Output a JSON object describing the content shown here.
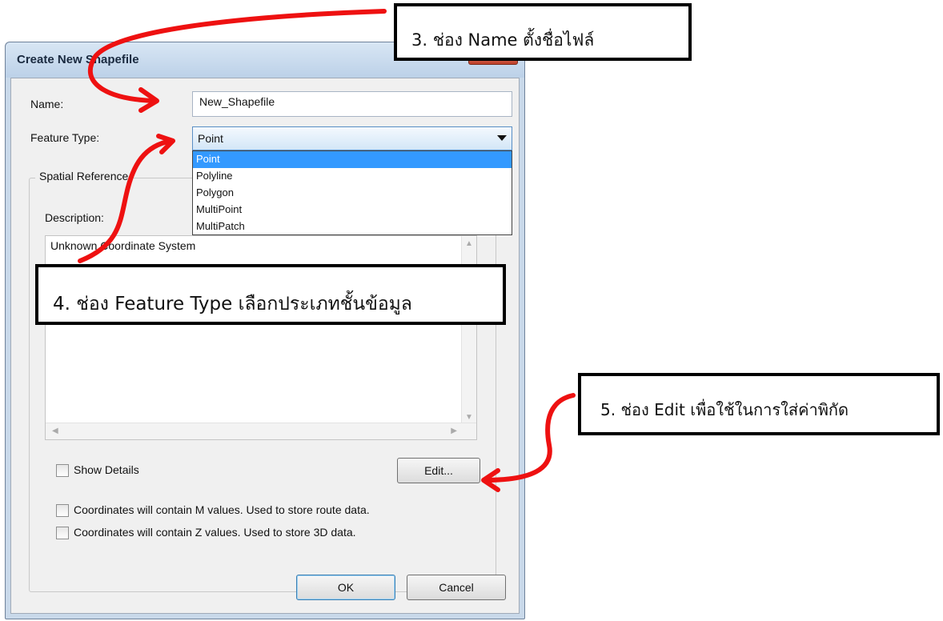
{
  "dialog": {
    "title": "Create New Shapefile",
    "name_label": "Name:",
    "name_value": "New_Shapefile",
    "feature_type_label": "Feature Type:",
    "feature_type_value": "Point",
    "feature_type_options": [
      "Point",
      "Polyline",
      "Polygon",
      "MultiPoint",
      "MultiPatch"
    ],
    "spatial_reference_title": "Spatial Reference",
    "description_label": "Description:",
    "description_value": "Unknown Coordinate System",
    "show_details_label": "Show Details",
    "edit_button": "Edit...",
    "m_values_label": "Coordinates will contain M values. Used to store route data.",
    "z_values_label": "Coordinates will contain Z values. Used to store 3D data.",
    "ok_button": "OK",
    "cancel_button": "Cancel"
  },
  "callouts": {
    "name_field": "3. ช่อง Name ตั้งชื่อไฟล์",
    "feature_type": "4. ช่อง Feature Type เลือกประเภทชั้นข้อมูล",
    "edit": "5. ช่อง Edit เพื่อใช้ในการใส่ค่าพิกัด"
  },
  "colors": {
    "arrow": "#ee1111",
    "selection": "#3399ff",
    "window_frame": "#c9d9ea"
  }
}
